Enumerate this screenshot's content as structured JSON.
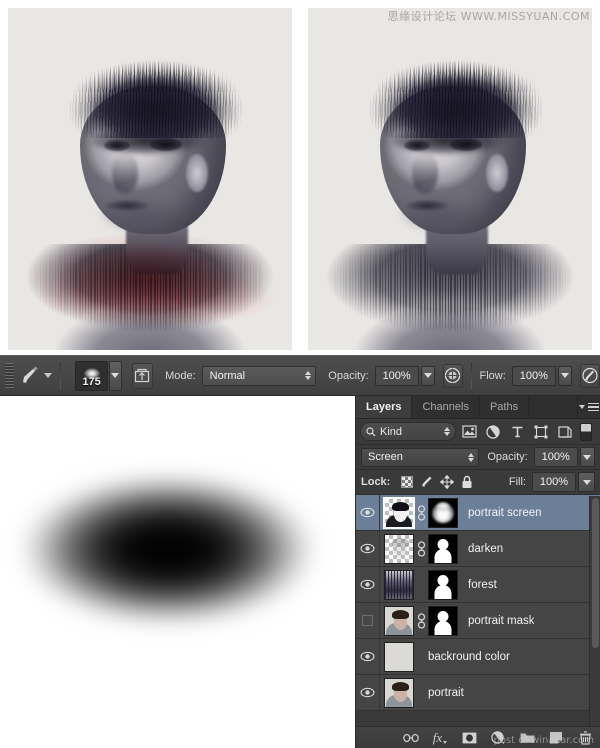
{
  "watermarks": {
    "top": "思缘设计论坛  WWW.MISSYUAN.COM",
    "bottom": "post of winakar.com"
  },
  "canvas": {
    "left_image_caption": "double-exposure portrait with red brush overlay on torso",
    "right_image_caption": "double-exposure portrait, forest texture, no red overlay"
  },
  "options_bar": {
    "tool": "brush-tool",
    "brush_size": "175",
    "mode_label": "Mode:",
    "mode_value": "Normal",
    "opacity_label": "Opacity:",
    "opacity_value": "100%",
    "flow_label": "Flow:",
    "flow_value": "100%",
    "airbrush_title": "Airbrush",
    "tablet_pressure_title": "Tablet pressure"
  },
  "mask_preview": {
    "description": "soft black elliptical brush mask on white"
  },
  "panel": {
    "tabs": [
      {
        "label": "Layers",
        "active": true
      },
      {
        "label": "Channels",
        "active": false
      },
      {
        "label": "Paths",
        "active": false
      }
    ],
    "filter": {
      "kind_label": "Kind",
      "icons": [
        "pixel-layer-icon",
        "adjustment-layer-icon",
        "type-layer-icon",
        "shape-layer-icon",
        "smart-object-icon"
      ]
    },
    "blend_mode": "Screen",
    "opacity_label": "Opacity:",
    "opacity_value": "100%",
    "lock_label": "Lock:",
    "lock_icons": [
      "lock-transparency-icon",
      "lock-image-icon",
      "lock-position-icon",
      "lock-all-icon"
    ],
    "fill_label": "Fill:",
    "fill_value": "100%",
    "layers": [
      {
        "name": "portrait screen",
        "visible": true,
        "selected": true,
        "has_mask": true,
        "linked": true,
        "thumb": "portrait-dark",
        "mask": "blob"
      },
      {
        "name": "darken",
        "visible": true,
        "selected": false,
        "has_mask": true,
        "linked": true,
        "thumb": "faint-portrait",
        "mask": "person"
      },
      {
        "name": "forest",
        "visible": true,
        "selected": false,
        "has_mask": true,
        "linked": false,
        "thumb": "forest",
        "mask": "person"
      },
      {
        "name": "portrait mask",
        "visible": false,
        "selected": false,
        "has_mask": true,
        "linked": true,
        "thumb": "portrait-photo",
        "mask": "person"
      },
      {
        "name": "backround color",
        "visible": true,
        "selected": false,
        "has_mask": false,
        "linked": false,
        "thumb": "solid-light",
        "mask": null
      },
      {
        "name": "portrait",
        "visible": true,
        "selected": false,
        "has_mask": false,
        "linked": false,
        "thumb": "portrait-photo",
        "mask": null
      }
    ],
    "footer_buttons": [
      "link-layers-icon",
      "layer-style-fx-icon",
      "add-layer-mask-icon",
      "new-adjustment-layer-icon",
      "new-group-icon",
      "new-layer-icon",
      "delete-layer-icon"
    ]
  },
  "colors": {
    "panel_bg": "#3a3a3a",
    "list_bg": "#454545",
    "selected_row": "#6b7f99",
    "options_bar": "#474747",
    "accent_red": "#d63a3e"
  }
}
